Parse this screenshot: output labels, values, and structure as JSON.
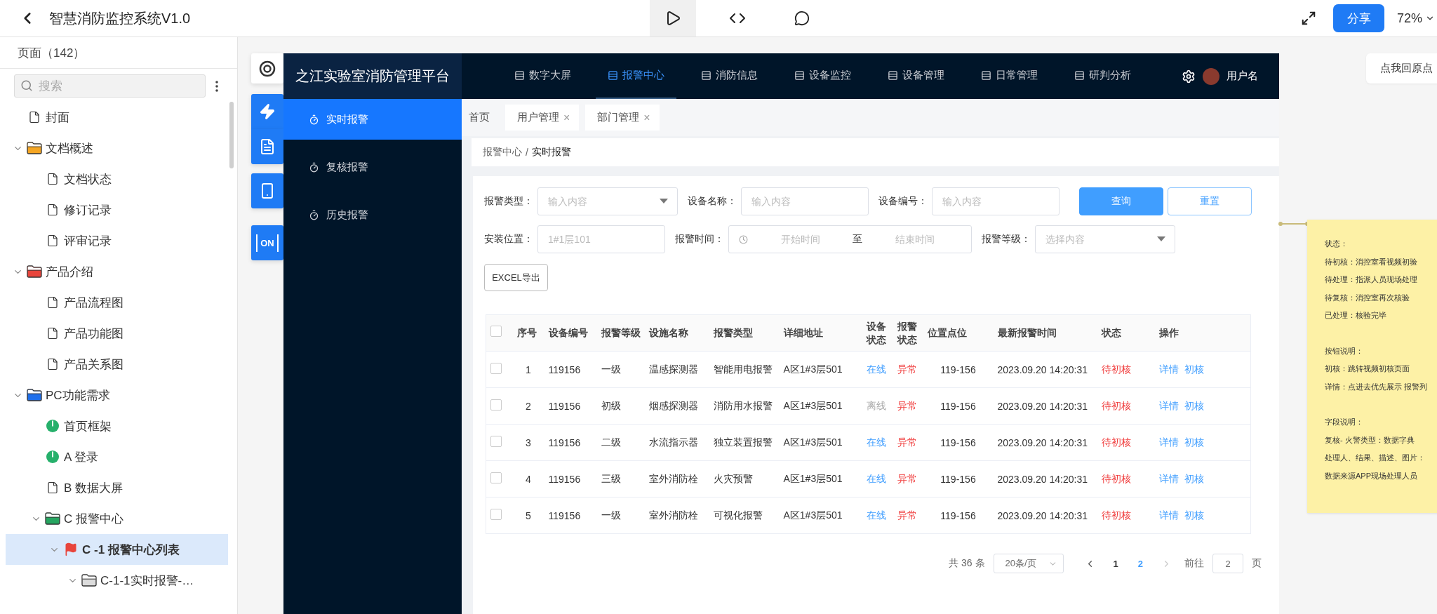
{
  "topbar": {
    "title": "智慧消防监控系统V1.0",
    "tools": [
      {
        "kind": "play",
        "selected": true
      },
      {
        "kind": "code",
        "selected": false
      },
      {
        "kind": "comment",
        "selected": false
      }
    ],
    "share": "分享",
    "zoom": "72%"
  },
  "pages": {
    "title": "页面（142）",
    "search": {
      "placeholder": "搜索"
    },
    "tree": [
      {
        "label": "封面",
        "kind": "page",
        "selected": false
      },
      {
        "label": "文档概述",
        "kind": "folder",
        "color": "#f5a623",
        "selected": false,
        "expanded": true,
        "children": [
          {
            "label": "文档状态",
            "kind": "page",
            "selected": false
          },
          {
            "label": "修订记录",
            "kind": "page",
            "selected": false
          },
          {
            "label": "评审记录",
            "kind": "page",
            "selected": false
          }
        ]
      },
      {
        "label": "产品介绍",
        "kind": "folder",
        "color": "#e8453c",
        "selected": false,
        "expanded": true,
        "children": [
          {
            "label": "产品流程图",
            "kind": "page",
            "selected": false
          },
          {
            "label": "产品功能图",
            "kind": "page",
            "selected": false
          },
          {
            "label": "产品关系图",
            "kind": "page",
            "selected": false
          }
        ]
      },
      {
        "label": "PC功能需求",
        "kind": "folder",
        "color": "#1f6feb",
        "selected": false,
        "expanded": true,
        "children": [
          {
            "label": "首页框架",
            "kind": "status",
            "selected": false
          },
          {
            "label": "A 登录",
            "kind": "status",
            "selected": false
          },
          {
            "label": "B 数据大屏",
            "kind": "page",
            "selected": false
          },
          {
            "label": "C 报警中心",
            "kind": "folder",
            "color": "#26a560",
            "selected": false,
            "expanded": true,
            "children": [
              {
                "label": "C -1 报警中心列表",
                "kind": "flag",
                "selected": true,
                "expanded": true,
                "children": [
                  {
                    "label": "C-1-1实时报警-…",
                    "kind": "folder",
                    "color": "#dcdcdc",
                    "selected": false,
                    "expanded": true
                  }
                ]
              }
            ]
          }
        ]
      }
    ]
  },
  "float_toolbar": [
    {
      "kind": "target"
    },
    {
      "kind": "bolt"
    },
    {
      "kind": "doc"
    },
    {
      "kind": "phone"
    },
    {
      "kind": "on",
      "label": "ON"
    }
  ],
  "prototype": {
    "logo": "之江实验室消防管理平台",
    "nav": [
      {
        "label": "数字大屏",
        "selected": false
      },
      {
        "label": "报警中心",
        "selected": true
      },
      {
        "label": "消防信息",
        "selected": false
      },
      {
        "label": "设备监控",
        "selected": false
      },
      {
        "label": "设备管理",
        "selected": false
      },
      {
        "label": "日常管理",
        "selected": false
      },
      {
        "label": "研判分析",
        "selected": false
      }
    ],
    "user": "用户名",
    "menu": [
      {
        "label": "实时报警",
        "selected": true
      },
      {
        "label": "复核报警",
        "selected": false
      },
      {
        "label": "历史报警",
        "selected": false
      }
    ],
    "tabs": [
      {
        "label": "首页",
        "closable": false,
        "selected": false
      },
      {
        "label": "用户管理",
        "closable": true,
        "close": "×",
        "selected": false
      },
      {
        "label": "部门管理",
        "closable": true,
        "close": "×",
        "selected": false
      }
    ],
    "breadcrumb": {
      "parent": "报警中心",
      "separator": "/",
      "current": "实时报警"
    },
    "filter_rows": [
      [
        {
          "kind": "select",
          "label": "报警类型：",
          "placeholder": "输入内容"
        },
        {
          "kind": "input",
          "label": "设备名称：",
          "placeholder": "输入内容"
        },
        {
          "kind": "input",
          "label": "设备编号：",
          "placeholder": "输入内容"
        }
      ],
      [
        {
          "kind": "input",
          "label": "安装位置：",
          "placeholder": "1#1层101"
        },
        {
          "kind": "daterange",
          "label": "报警时间：",
          "start": {
            "placeholder": "开始时间"
          },
          "separator": "至",
          "end": {
            "placeholder": "结束时间"
          }
        },
        {
          "kind": "select",
          "label": "报警等级：",
          "placeholder": "选择内容"
        }
      ]
    ],
    "buttons": [
      {
        "label": "查询",
        "kind": "primary"
      },
      {
        "label": "重置",
        "kind": "outline"
      }
    ],
    "export": "EXCEL导出",
    "table": {
      "select_all": {
        "checked": false
      },
      "columns": [
        "序号",
        "设备编号",
        "报警等级",
        "设施名称",
        "报警类型",
        "详细地址",
        "设备状态",
        "报警状态",
        "位置点位",
        "最新报警时间",
        "状态",
        "操作"
      ],
      "rows": [
        {
          "checked": false,
          "cells": [
            "1",
            "119156",
            "一级",
            "温感探测器",
            "智能用电报警",
            "A区1#3层501"
          ],
          "device_status": {
            "text": "在线",
            "online": true
          },
          "alarm_status": "异常",
          "position": "119-156",
          "time": "2023.09.20 14:20:31",
          "status": "待初核",
          "actions": [
            "详情",
            "初核"
          ]
        },
        {
          "checked": false,
          "cells": [
            "2",
            "119156",
            "初级",
            "烟感探测器",
            "消防用水报警",
            "A区1#3层501"
          ],
          "device_status": {
            "text": "离线",
            "online": false
          },
          "alarm_status": "异常",
          "position": "119-156",
          "time": "2023.09.20 14:20:31",
          "status": "待初核",
          "actions": [
            "详情",
            "初核"
          ]
        },
        {
          "checked": false,
          "cells": [
            "3",
            "119156",
            "二级",
            "水流指示器",
            "独立装置报警",
            "A区1#3层501"
          ],
          "device_status": {
            "text": "在线",
            "online": true
          },
          "alarm_status": "异常",
          "position": "119-156",
          "time": "2023.09.20 14:20:31",
          "status": "待初核",
          "actions": [
            "详情",
            "初核"
          ]
        },
        {
          "checked": false,
          "cells": [
            "4",
            "119156",
            "三级",
            "室外消防栓",
            "火灾预警",
            "A区1#3层501"
          ],
          "device_status": {
            "text": "在线",
            "online": true
          },
          "alarm_status": "异常",
          "position": "119-156",
          "time": "2023.09.20 14:20:31",
          "status": "待初核",
          "actions": [
            "详情",
            "初核"
          ]
        },
        {
          "checked": false,
          "cells": [
            "5",
            "119156",
            "一级",
            "室外消防栓",
            "可视化报警",
            "A区1#3层501"
          ],
          "device_status": {
            "text": "在线",
            "online": true
          },
          "alarm_status": "异常",
          "position": "119-156",
          "time": "2023.09.20 14:20:31",
          "status": "待初核",
          "actions": [
            "详情",
            "初核"
          ]
        }
      ]
    },
    "pagination": {
      "total": "共 36 条",
      "page_size": "20条/页",
      "pages": [
        {
          "label": "1",
          "selected": false
        },
        {
          "label": "2",
          "selected": true
        }
      ],
      "goto_label": "前往",
      "goto_value": "2",
      "goto_suffix": "页"
    }
  },
  "note": {
    "sections": [
      {
        "lines": [
          "状态：",
          "待初核：消控室看视频初验",
          "待处理：指派人员现场处理",
          "待复核：消控室再次核验",
          "已处理：核验完毕"
        ]
      },
      {
        "lines": [
          "按钮说明：",
          "初核：跳转视频初核页面",
          "详情：点进去优先展示 报警列"
        ]
      },
      {
        "lines": [
          "字段说明：",
          "复核- 火警类型：数据字典",
          "处理人、结果、描述、图片：",
          "数据来源APP现场处理人员"
        ]
      }
    ]
  },
  "home_button": "点我回原点"
}
